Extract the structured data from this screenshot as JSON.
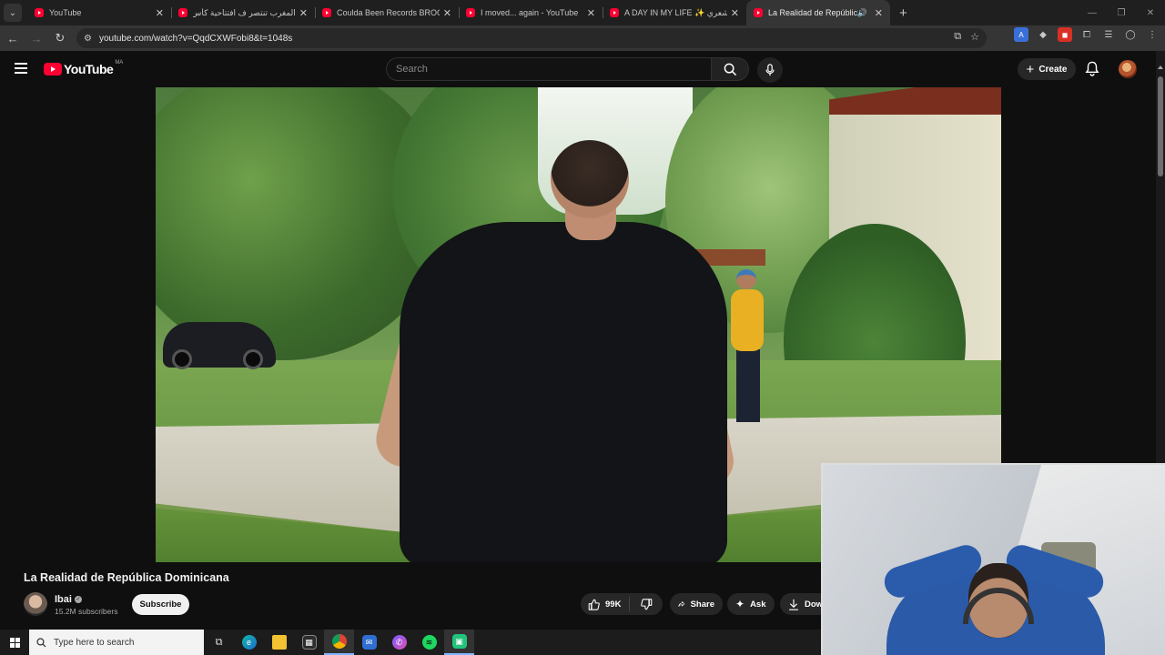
{
  "browser": {
    "tabs": [
      {
        "title": "YouTube",
        "active": false
      },
      {
        "title": "المغرب تنتصر ف افتتاحية كأس الأ",
        "active": false
      },
      {
        "title": "Coulda Been Records BROOKLY",
        "active": false
      },
      {
        "title": "I moved... again - YouTube",
        "active": false
      },
      {
        "title": "A DAY IN MY LIFE ✨ بعت شعري",
        "active": false
      },
      {
        "title": "La Realidad de República D",
        "active": true
      }
    ],
    "url": "youtube.com/watch?v=QqdCXWFobi8&t=1048s"
  },
  "youtube": {
    "logo_text": "YouTube",
    "country_code": "MA",
    "search_placeholder": "Search",
    "create_label": "Create"
  },
  "video": {
    "title": "La Realidad de República Dominicana",
    "channel": "Ibai",
    "subscribers": "15.2M subscribers",
    "subscribe_label": "Subscribe",
    "likes": "99K",
    "share_label": "Share",
    "ask_label": "Ask",
    "download_label": "Dow"
  },
  "taskbar": {
    "search_placeholder": "Type here to search"
  },
  "colors": {
    "yt_red": "#ff0033",
    "background": "#0f0f0f"
  }
}
